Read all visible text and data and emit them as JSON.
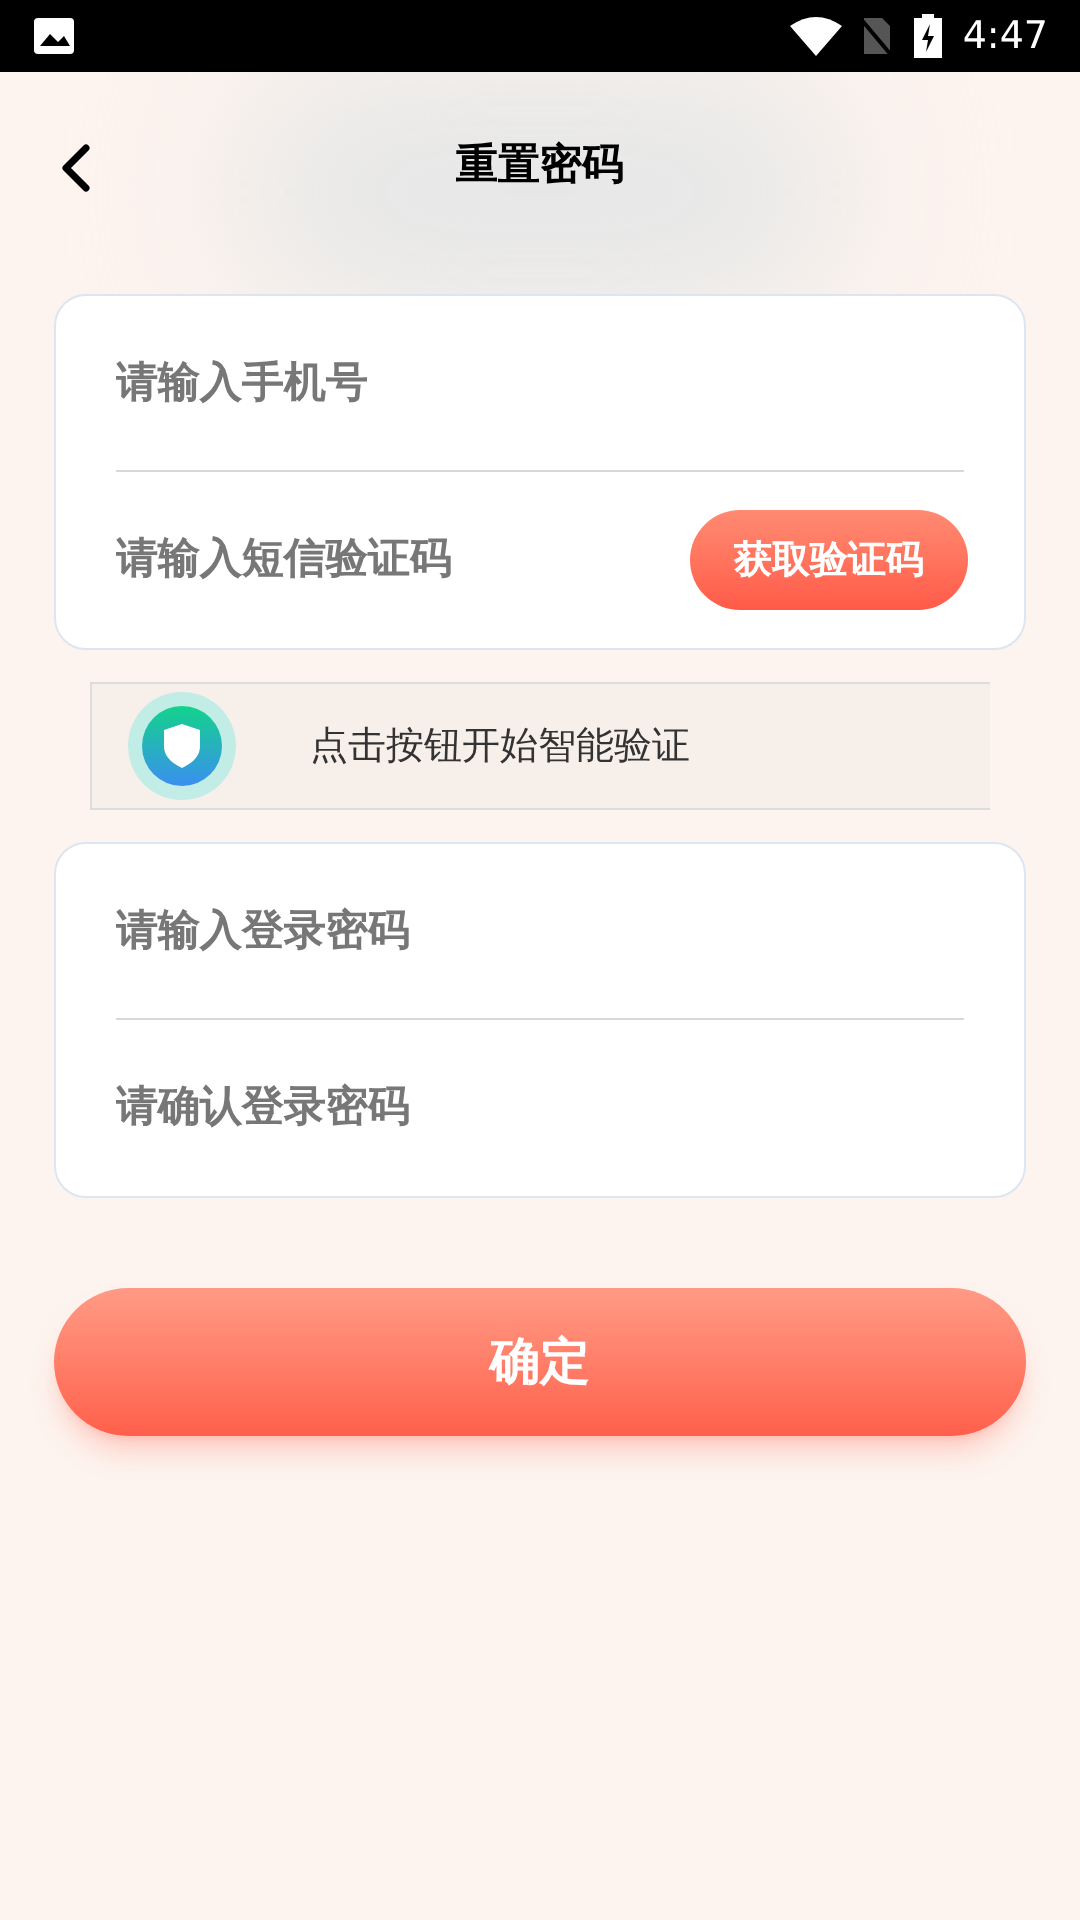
{
  "status_bar": {
    "time": "4:47"
  },
  "header": {
    "title": "重置密码"
  },
  "card_1": {
    "fields": [
      {
        "kind": "text",
        "placeholder": "请输入手机号"
      },
      {
        "kind": "code",
        "placeholder": "请输入短信验证码",
        "button": "获取验证码"
      }
    ]
  },
  "verify_bar": {
    "text": "点击按钮开始智能验证"
  },
  "card_2": {
    "fields": [
      {
        "kind": "text",
        "placeholder": "请输入登录密码"
      },
      {
        "kind": "text",
        "placeholder": "请确认登录密码"
      }
    ]
  },
  "confirm_button": "确定"
}
